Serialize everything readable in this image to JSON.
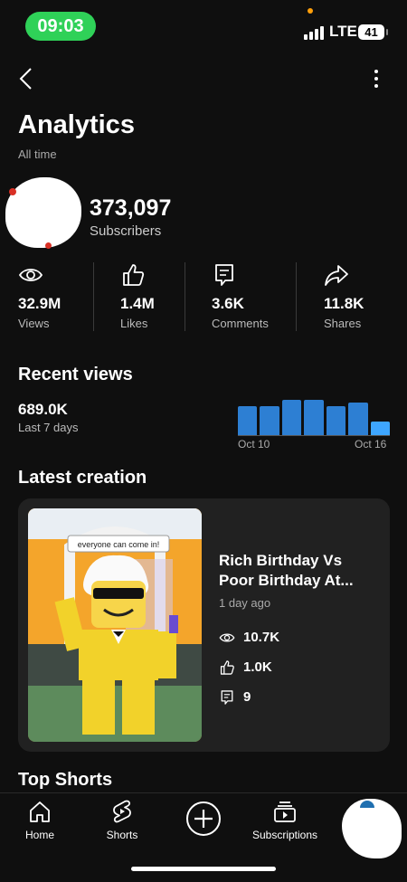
{
  "status_bar": {
    "time": "09:03",
    "network": "LTE",
    "battery": "41"
  },
  "header": {
    "title": "Analytics",
    "subtitle": "All time"
  },
  "channel": {
    "subscribers": "373,097",
    "subscribers_label": "Subscribers"
  },
  "stats": [
    {
      "icon": "eye-icon",
      "value": "32.9M",
      "label": "Views"
    },
    {
      "icon": "thumbs-up-icon",
      "value": "1.4M",
      "label": "Likes"
    },
    {
      "icon": "comment-icon",
      "value": "3.6K",
      "label": "Comments"
    },
    {
      "icon": "share-icon",
      "value": "11.8K",
      "label": "Shares"
    }
  ],
  "recent_views": {
    "title": "Recent views",
    "value": "689.0K",
    "period": "Last 7 days",
    "chart_data": {
      "type": "bar",
      "values": [
        0.72,
        0.7,
        0.86,
        0.86,
        0.7,
        0.8,
        0.35
      ],
      "x_start_label": "Oct 10",
      "x_end_label": "Oct 16",
      "bar_color": "#2d7fd3",
      "last_bar_color": "#3ea6ff"
    }
  },
  "latest_creation": {
    "title": "Latest creation",
    "thumbnail_sign": "everyone can come in!",
    "video_title": "Rich Birthday Vs Poor Birthday At...",
    "age": "1 day ago",
    "views": "10.7K",
    "likes": "1.0K",
    "comments": "9"
  },
  "top_shorts": {
    "title": "Top Shorts"
  },
  "nav": {
    "home": "Home",
    "shorts": "Shorts",
    "subscriptions": "Subscriptions"
  },
  "colors": {
    "background": "#0f0f0f",
    "card": "#212121",
    "accent": "#3ea6ff",
    "time_pill": "#2fd158"
  }
}
